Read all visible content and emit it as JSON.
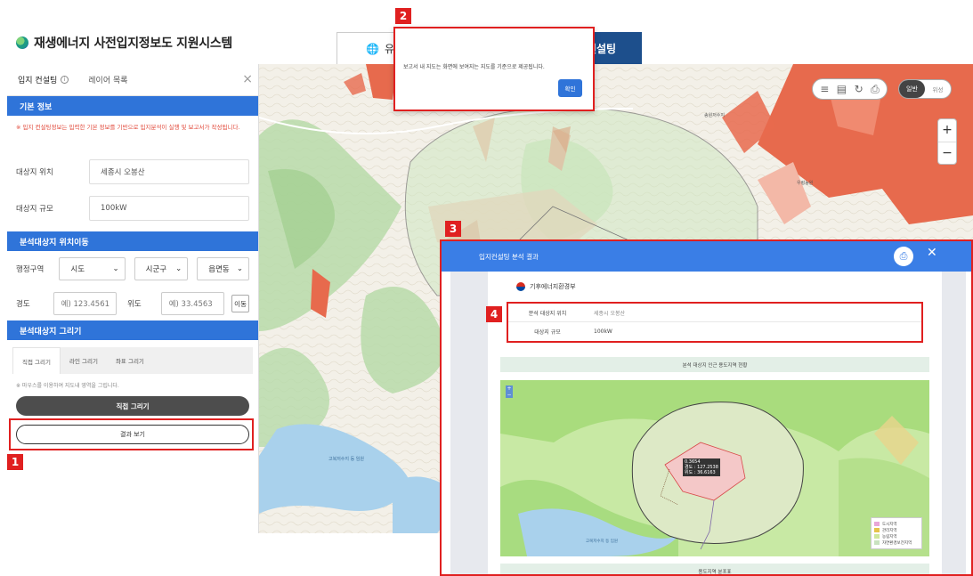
{
  "header": {
    "app_title": "재생에너지 사전입지정보도 지원시스템",
    "tab_partial": "유",
    "tab_active": "컨설팅"
  },
  "panel": {
    "tabs": [
      "입지 컨설팅",
      "레이어 목록"
    ],
    "section_basic": "기본 정보",
    "notice": "※ 입지 컨설팅정보는 입력한 기본 정보를 기반으로 입지분석이 실행 및 보고서가 작성됩니다.",
    "location_label": "대상지 위치",
    "location_value": "세종시 오봉산",
    "scale_label": "대상지 규모",
    "scale_value": "100kW",
    "section_move": "분석대상지 위치이동",
    "admin_label": "행정구역",
    "sido": "시도",
    "sigungu": "시군구",
    "eupmyeondong": "읍면동",
    "lon_label": "경도",
    "lon_placeholder": "예) 123.4561",
    "lat_label": "위도",
    "lat_placeholder": "예) 33.4563",
    "move_button": "이동",
    "section_draw": "분석대상지 그리기",
    "draw_tabs": [
      "직접 그리기",
      "라인 그리기",
      "좌표 그리기"
    ],
    "draw_hint": "※ 마우스를 이용하여 지도내 영역을 그립니다.",
    "draw_button": "직접 그리기",
    "result_button": "결과 보기"
  },
  "dialog": {
    "message": "보고서 내 지도는 화면에 보여지는 지도를 기준으로 제공됩니다.",
    "ok": "확인"
  },
  "map_controls": {
    "basemap_on": "일반",
    "basemap_off": "위성",
    "zoom_in": "+",
    "zoom_out": "−"
  },
  "map_labels": [
    "송원저수지",
    "고복저수지 등 임원",
    "고복저수지 등 임원",
    "우렁농원"
  ],
  "popup": {
    "title": "입지컨설팅 분석 결과",
    "ministry": "기후에너지환경부",
    "info": [
      {
        "key": "분석 대상지 위치",
        "value": "세종시 오봉산"
      },
      {
        "key": "대상지 규모",
        "value": "100kW"
      }
    ],
    "map_section": "분석 대상지 인근 용도지역 현황",
    "dist_section": "용도지역 분포표",
    "marker_lines": [
      "0.3654",
      "경도 : 127.2538",
      "위도 : 36.6163"
    ],
    "lake_label": "고복저수지 등 임원",
    "legend": [
      {
        "label": "도시지역",
        "color": "#e9a6d8"
      },
      {
        "label": "관리지역",
        "color": "#e6c34b"
      },
      {
        "label": "농림지역",
        "color": "#cfe79a"
      },
      {
        "label": "자연환경보전지역",
        "color": "#c9e2c0"
      }
    ]
  },
  "callouts": [
    "1",
    "2",
    "3",
    "4"
  ],
  "colors": {
    "primary_blue": "#2f74d9",
    "header_navy": "#1d4f8c",
    "highlight_red": "#e02020"
  }
}
